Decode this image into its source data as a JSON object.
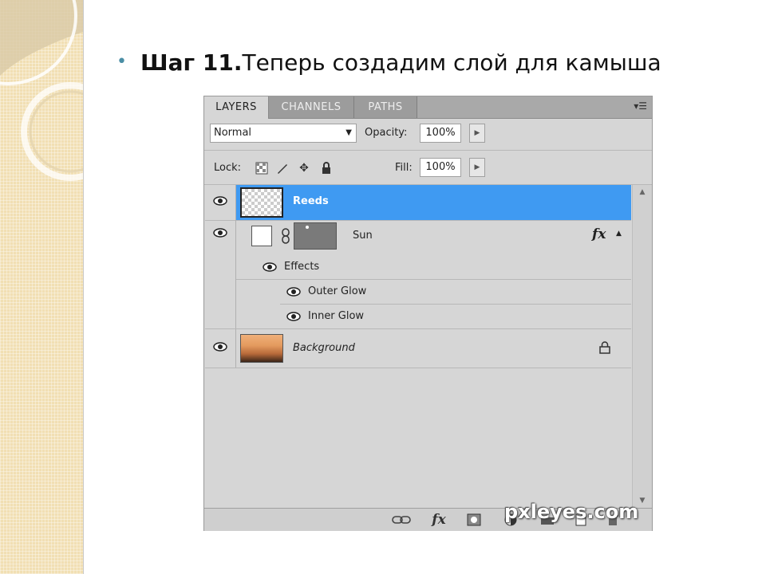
{
  "slide": {
    "bullet": "•",
    "title_bold": "Шаг 11.",
    "title_rest": "Теперь создадим слой для камыша"
  },
  "panel": {
    "tabs": [
      {
        "label": "LAYERS",
        "active": true
      },
      {
        "label": "CHANNELS",
        "active": false
      },
      {
        "label": "PATHS",
        "active": false
      }
    ],
    "menu_icon": "panel-menu-icon",
    "blend_mode": "Normal",
    "opacity_label": "Opacity:",
    "opacity_value": "100%",
    "lock_label": "Lock:",
    "fill_label": "Fill:",
    "fill_value": "100%",
    "lock_icons": [
      "lock-transparent-icon",
      "lock-image-icon",
      "lock-position-icon",
      "lock-all-icon"
    ],
    "layers": [
      {
        "name": "Reeds",
        "selected": true,
        "visible": true
      },
      {
        "name": "Sun",
        "fx_label": "fx",
        "visible": true
      },
      {
        "name": "Effects"
      },
      {
        "name": "Outer Glow"
      },
      {
        "name": "Inner Glow"
      },
      {
        "name": "Background",
        "locked": true,
        "visible": true
      }
    ],
    "bottom_icons": [
      "link-icon",
      "fx-icon",
      "mask-icon",
      "adjustment-icon",
      "folder-icon",
      "new-layer-icon",
      "trash-icon"
    ],
    "bottom_fx": "fx"
  },
  "watermark": "pxleyes.com",
  "colors": {
    "selected": "#3f9af2",
    "bullet": "#4a8ea5",
    "panel": "#d6d6d6"
  }
}
